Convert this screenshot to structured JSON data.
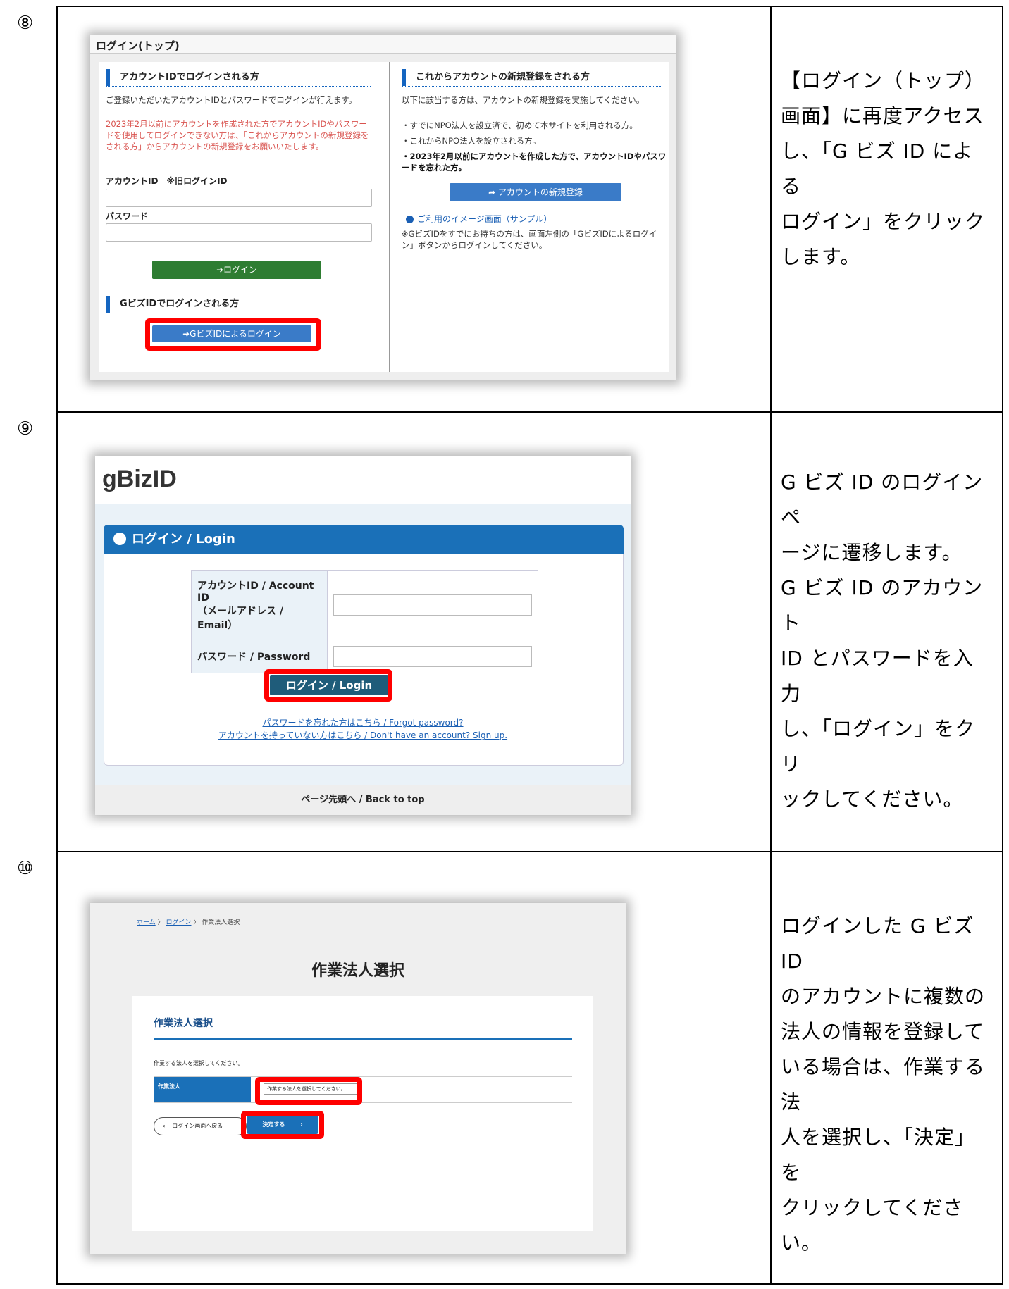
{
  "rows": [
    {
      "num": "⑧",
      "desc": "【ログイン（トップ）\n画面】に再度アクセス\nし、「G ビズ ID による\nログイン」をクリック\nします。"
    },
    {
      "num": "⑨",
      "desc": "G ビズ ID のログインペ\nージに遷移します。\nG ビズ ID のアカウント\nID とパスワードを入力\nし、「ログイン」をクリ\nックしてください。"
    },
    {
      "num": "⑩",
      "desc": "ログインした G ビズ ID\nのアカウントに複数の\n法人の情報を登録して\nいる場合は、作業する法\n人を選択し、「決定」を\nクリックしてください。"
    }
  ],
  "s8": {
    "title": "ログイン(トップ)",
    "left": {
      "heading": "アカウントIDでログインされる方",
      "intro": "ご登録いただいたアカウントIDとパスワードでログインが行えます。",
      "note": "2023年2月以前にアカウントを作成された方でアカウントIDやパスワードを使用してログインできない方は、「これからアカウントの新規登録をされる方」からアカウントの新規登録をお願いいたします。",
      "id_label": "アカウントID　※旧ログインID",
      "pw_label": "パスワード",
      "login_button": "➜ログイン",
      "gbiz_heading": "GビズIDでログインされる方",
      "gbiz_button": "➜GビズIDによるログイン"
    },
    "right": {
      "heading": "これからアカウントの新規登録をされる方",
      "intro": "以下に該当する方は、アカウントの新規登録を実施してください。",
      "bullet1": "・すでにNPO法人を設立済で、初めて本サイトを利用される方。",
      "bullet2": "・これからNPO法人を設立される方。",
      "bullet3": "・2023年2月以前にアカウントを作成した方で、アカウントIDやパスワードを忘れた方。",
      "register_button": "➦ アカウントの新規登録",
      "sample_link": "ご利用のイメージ画面（サンプル）",
      "note": "※GビズIDをすでにお持ちの方は、画面左側の「GビズIDによるログイン」ボタンからログインしてください。"
    }
  },
  "s9": {
    "logo": "gBizID",
    "card_title": "ログイン / Login",
    "id_label": "アカウントID / Account ID\n（メールアドレス / Email）",
    "pw_label": "パスワード / Password",
    "login_button": "ログイン / Login",
    "forgot_link": "パスワードを忘れた方はこちら / Forgot password?",
    "signup_link": "アカウントを持っていない方はこちら / Don't have an account? Sign up.",
    "back_to_top": "ページ先頭へ / Back to top"
  },
  "s10": {
    "breadcrumb_home": "ホーム",
    "breadcrumb_login": "ログイン",
    "breadcrumb_current": "作業法人選択",
    "page_title": "作業法人選択",
    "section_title": "作業法人選択",
    "instruction": "作業する法人を選択してください。",
    "field_label": "作業法人",
    "select_placeholder": "作業する法人を選択してください。",
    "back_button": "ログイン画面へ戻る",
    "decide_button": "決定する"
  },
  "colors": {
    "highlight": "#ff0000",
    "gbiz_blue": "#1a70b8",
    "login_green": "#2e7d32"
  }
}
